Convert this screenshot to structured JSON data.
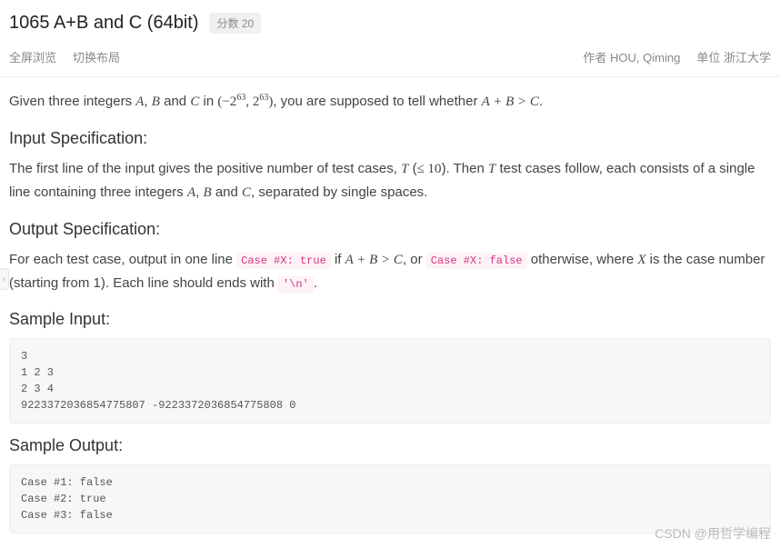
{
  "header": {
    "title": "1065 A+B and C (64bit)",
    "score_label": "分数 20"
  },
  "subbar": {
    "fullscreen": "全屏浏览",
    "switch_layout": "切换布局",
    "author_label": "作者",
    "author_name": "HOU, Qiming",
    "unit_label": "单位",
    "unit_name": "浙江大学"
  },
  "intro": {
    "t1": "Given three integers ",
    "A": "A",
    "t2": ", ",
    "B": "B",
    "t3": " and ",
    "C": "C",
    "t4": " in ",
    "range": "(−2",
    "exp": "63",
    "range2": ", 2",
    "range3": ")",
    "t5": ", you are supposed to tell whether ",
    "expr": "A + B > C",
    "t6": "."
  },
  "input_spec": {
    "heading": "Input Specification:",
    "t1": "The first line of the input gives the positive number of test cases, ",
    "T": "T",
    "t2": " (",
    "le": "≤ 10",
    "t3": "). Then ",
    "t4": " test cases follow, each consists of a single line containing three integers ",
    "A": "A",
    "c1": ", ",
    "B": "B",
    "c2": " and ",
    "C": "C",
    "t5": ", separated by single spaces."
  },
  "output_spec": {
    "heading": "Output Specification:",
    "t1": "For each test case, output in one line ",
    "code_true": "Case #X: true",
    "t2": " if ",
    "expr": "A + B > C",
    "t3": ", or ",
    "code_false": "Case #X: false",
    "t4": " otherwise, where ",
    "X": "X",
    "t5": " is the case number (starting from 1). Each line should ends with ",
    "code_nl": "'\\n'",
    "t6": "."
  },
  "sample_input": {
    "heading": "Sample Input:",
    "text": "3\n1 2 3\n2 3 4\n9223372036854775807 -9223372036854775808 0"
  },
  "sample_output": {
    "heading": "Sample Output:",
    "text": "Case #1: false\nCase #2: true\nCase #3: false"
  },
  "watermark": "CSDN @用哲学编程",
  "edge_handle": "›"
}
